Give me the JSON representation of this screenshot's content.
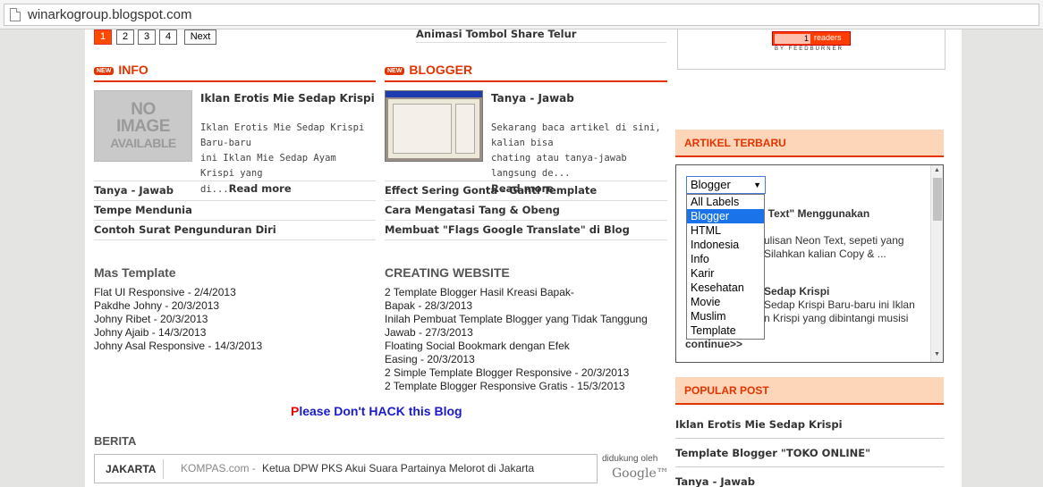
{
  "browser": {
    "url": "winarkogroup.blogspot.com"
  },
  "pagination": {
    "pages": [
      "1",
      "2",
      "3",
      "4"
    ],
    "next": "Next"
  },
  "top_link": "Animasi Tombol Share Telur",
  "info": {
    "badge": "NEW",
    "title": "INFO",
    "thumb_text": [
      "NO",
      "IMAGE",
      "AVAILABLE"
    ],
    "post_title": "Iklan Erotis Mie Sedap Krispi",
    "post_desc": [
      "Iklan Erotis Mie Sedap Krispi Baru-baru",
      "ini Iklan Mie Sedap Ayam Krispi yang",
      "di..."
    ],
    "read_more": "Read more",
    "links": [
      "Tanya - Jawab",
      "Tempe Mendunia",
      "Contoh Surat Pengunduran Diri"
    ]
  },
  "blogger": {
    "badge": "NEW",
    "title": "BLOGGER",
    "post_title": "Tanya - Jawab",
    "post_desc": [
      "Sekarang baca artikel di sini, kalian bisa",
      "chating atau tanya-jawab langsung de..."
    ],
    "read_more": "Read more",
    "links": [
      "Effect Sering Gonta - Ganti Template",
      "Cara Mengatasi Tang & Obeng",
      "Membuat \"Flags Google Translate\" di Blog"
    ]
  },
  "mas_template": {
    "title": "Mas Template",
    "items": [
      "Flat UI Responsive - 2/4/2013",
      "Pakdhe Johny - 20/3/2013",
      "Johny Ribet - 20/3/2013",
      "Johny Ajaib - 14/3/2013",
      "Johny Asal Responsive - 14/3/2013"
    ]
  },
  "creating_website": {
    "title": "CREATING WEBSITE",
    "lines": [
      "2 Template Blogger Hasil Kreasi Bapak-",
      "Bapak - 28/3/2013",
      "Inilah Pembuat Template Blogger yang Tidak Tanggung",
      "Jawab - 27/3/2013",
      "Floating Social Bookmark dengan Efek",
      "Easing - 20/3/2013",
      "2 Simple Template Blogger Responsive - 20/3/2013",
      "2 Template Blogger Responsive Gratis - 15/3/2013"
    ]
  },
  "hack": {
    "first": "P",
    "rest": "lease Don't HACK this Blog"
  },
  "berita": {
    "title": "BERITA",
    "city": "JAKARTA",
    "source": "KOMPAS.com -",
    "headline": "Ketua DPW PKS Akui Suara Partainya Melorot di Jakarta",
    "supported": "didukung oleh",
    "google": "Google™"
  },
  "feedburner": {
    "count": "1",
    "label": "readers",
    "by": "BY FEEDBURNER"
  },
  "artikel": {
    "title": "ARTIKEL TERBARU",
    "selected": "Blogger",
    "options": [
      "All Labels",
      "Blogger",
      "HTML",
      "Indonesia",
      "Info",
      "Karir",
      "Kesehatan",
      "Movie",
      "Muslim",
      "Template"
    ],
    "behind_1": "n Text\" Menggunakan",
    "behind_2": "ulisan Neon Text, sepeti yang",
    "behind_3": "Silahkan kalian Copy & ...",
    "behind_4": "Sedap Krispi",
    "behind_5": "Sedap Krispi Baru-baru ini Iklan",
    "behind_6": "n Krispi yang dibintangi musisi",
    "continue": "continue>>"
  },
  "popular": {
    "title": "POPULAR POST",
    "items": [
      "Iklan Erotis Mie Sedap Krispi",
      "Template Blogger \"TOKO ONLINE\"",
      "Tanya - Jawab"
    ]
  }
}
